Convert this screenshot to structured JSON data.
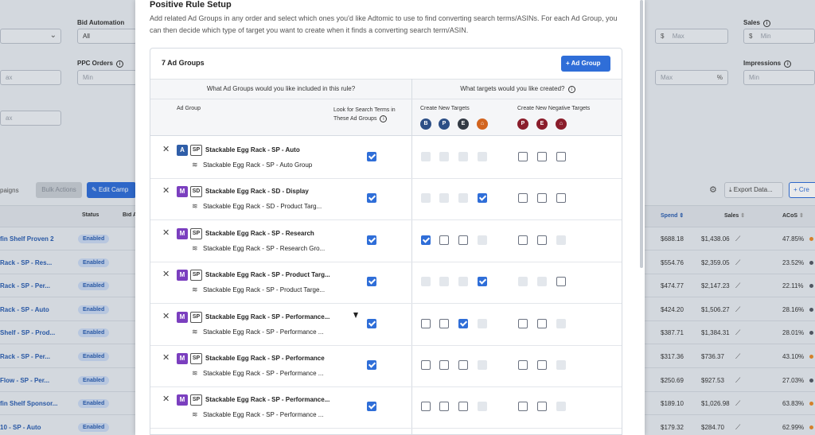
{
  "background": {
    "filters": {
      "bid_automation_label": "Bid Automation",
      "bid_automation_value": "All",
      "ppc_orders_label": "PPC Orders",
      "ppc_orders_placeholder": "Min",
      "left_max1": "ax",
      "left_max2": "ax",
      "spend_max_placeholder": "Max",
      "acos_max_placeholder": "Max",
      "acos_unit": "%",
      "sales_label": "Sales",
      "sales_min_placeholder": "Min",
      "impressions_label": "Impressions",
      "impressions_min_placeholder": "Min",
      "currency": "$"
    },
    "toolbar": {
      "campaigns_tab": "paigns",
      "bulk_actions": "Bulk Actions",
      "edit_campaign": "Edit Camp",
      "export_data": "Export Data...",
      "create": "Cre"
    },
    "table_headers": {
      "status": "Status",
      "bid": "Bid A",
      "spend": "Spend",
      "sales": "Sales",
      "acos": "ACoS"
    },
    "rows": [
      {
        "name": "fin Shelf Proven 2",
        "status": "Enabled",
        "spend": "$688.18",
        "sales": "$1,438.06",
        "acos": "47.85%",
        "acos_color": "#e8892b"
      },
      {
        "name": "Rack - SP - Res...",
        "status": "Enabled",
        "spend": "$554.76",
        "sales": "$2,359.05",
        "acos": "23.52%",
        "acos_color": "#555b66"
      },
      {
        "name": "Rack - SP - Per...",
        "status": "Enabled",
        "spend": "$474.77",
        "sales": "$2,147.23",
        "acos": "22.11%",
        "acos_color": "#555b66"
      },
      {
        "name": "Rack - SP - Auto",
        "status": "Enabled",
        "spend": "$424.20",
        "sales": "$1,506.27",
        "acos": "28.16%",
        "acos_color": "#555b66"
      },
      {
        "name": "Shelf - SP - Prod...",
        "status": "Enabled",
        "spend": "$387.71",
        "sales": "$1,384.31",
        "acos": "28.01%",
        "acos_color": "#555b66"
      },
      {
        "name": "Rack - SP - Per...",
        "status": "Enabled",
        "spend": "$317.36",
        "sales": "$736.37",
        "acos": "43.10%",
        "acos_color": "#e8892b"
      },
      {
        "name": "Flow - SP - Per...",
        "status": "Enabled",
        "spend": "$250.69",
        "sales": "$927.53",
        "acos": "27.03%",
        "acos_color": "#555b66"
      },
      {
        "name": "fin Shelf Sponsor...",
        "status": "Enabled",
        "spend": "$189.10",
        "sales": "$1,026.98",
        "acos": "63.83%",
        "acos_color": "#e8892b"
      },
      {
        "name": "10 - SP - Auto",
        "status": "Enabled",
        "spend": "$179.32",
        "sales": "$284.70",
        "acos": "62.99%",
        "acos_color": "#e8892b"
      }
    ]
  },
  "modal": {
    "title": "Positive Rule Setup",
    "description": "Add related Ad Groups in any order and select which ones you'd like Adtomic to use to find converting search terms/ASINs. For each Ad Group, you can then decide which type of target you want to create when it finds a converting search term/ASIN.",
    "ad_group_count": "7 Ad Groups",
    "add_button": "Ad Group",
    "left_header": "What Ad Groups would you like included in this rule?",
    "right_header": "What targets would you like created?",
    "col_ad_group": "Ad Group",
    "col_look_for": "Look for Search Terms in These Ad Groups",
    "create_new_targets": "Create New Targets",
    "create_new_negative_targets": "Create New Negative Targets",
    "target_icons": [
      {
        "letter": "B",
        "color": "#2d4f86"
      },
      {
        "letter": "P",
        "color": "#2d4f86"
      },
      {
        "letter": "E",
        "color": "#333a44"
      },
      {
        "letter": "⌂",
        "color": "#d2641f"
      }
    ],
    "negative_icons": [
      {
        "letter": "P",
        "color": "#8a1d2b"
      },
      {
        "letter": "E",
        "color": "#8a1d2b"
      },
      {
        "letter": "⌂",
        "color": "#8a1d2b"
      }
    ],
    "ad_groups": [
      {
        "type": "A",
        "type_color": "#2f5ea8",
        "kind": "SP",
        "campaign": "Stackable Egg Rack - SP - Auto",
        "group": "Stackable Egg Rack - SP - Auto Group",
        "look": "on",
        "targets": [
          "dis",
          "dis",
          "dis",
          "dis"
        ],
        "negatives": [
          "off",
          "off",
          "off"
        ]
      },
      {
        "type": "M",
        "type_color": "#7b3fbf",
        "kind": "SD",
        "campaign": "Stackable Egg Rack - SD - Display",
        "group": "Stackable Egg Rack - SD - Product Targ...",
        "look": "on",
        "targets": [
          "dis",
          "dis",
          "dis",
          "on"
        ],
        "negatives": [
          "off",
          "off",
          "off"
        ]
      },
      {
        "type": "M",
        "type_color": "#7b3fbf",
        "kind": "SP",
        "campaign": "Stackable Egg Rack - SP - Research",
        "group": "Stackable Egg Rack - SP - Research Gro...",
        "look": "on",
        "targets": [
          "on",
          "off",
          "off",
          "dis"
        ],
        "negatives": [
          "off",
          "off",
          "dis"
        ]
      },
      {
        "type": "M",
        "type_color": "#7b3fbf",
        "kind": "SP",
        "campaign": "Stackable Egg Rack - SP - Product Targ...",
        "group": "Stackable Egg Rack - SP - Product Targe...",
        "look": "on",
        "targets": [
          "dis",
          "dis",
          "dis",
          "on"
        ],
        "negatives": [
          "dis",
          "dis",
          "off"
        ]
      },
      {
        "type": "M",
        "type_color": "#7b3fbf",
        "kind": "SP",
        "campaign": "Stackable Egg Rack - SP - Performance...",
        "group": "Stackable Egg Rack - SP - Performance ...",
        "look": "on",
        "targets": [
          "off",
          "off",
          "on",
          "dis"
        ],
        "negatives": [
          "off",
          "off",
          "dis"
        ]
      },
      {
        "type": "M",
        "type_color": "#7b3fbf",
        "kind": "SP",
        "campaign": "Stackable Egg Rack - SP - Performance",
        "group": "Stackable Egg Rack - SP - Performance ...",
        "look": "on",
        "targets": [
          "off",
          "off",
          "off",
          "dis"
        ],
        "negatives": [
          "off",
          "off",
          "dis"
        ]
      },
      {
        "type": "M",
        "type_color": "#7b3fbf",
        "kind": "SP",
        "campaign": "Stackable Egg Rack - SP - Performance...",
        "group": "Stackable Egg Rack - SP - Performance ...",
        "look": "on",
        "targets": [
          "off",
          "off",
          "off",
          "dis"
        ],
        "negatives": [
          "off",
          "off",
          "dis"
        ]
      }
    ]
  }
}
